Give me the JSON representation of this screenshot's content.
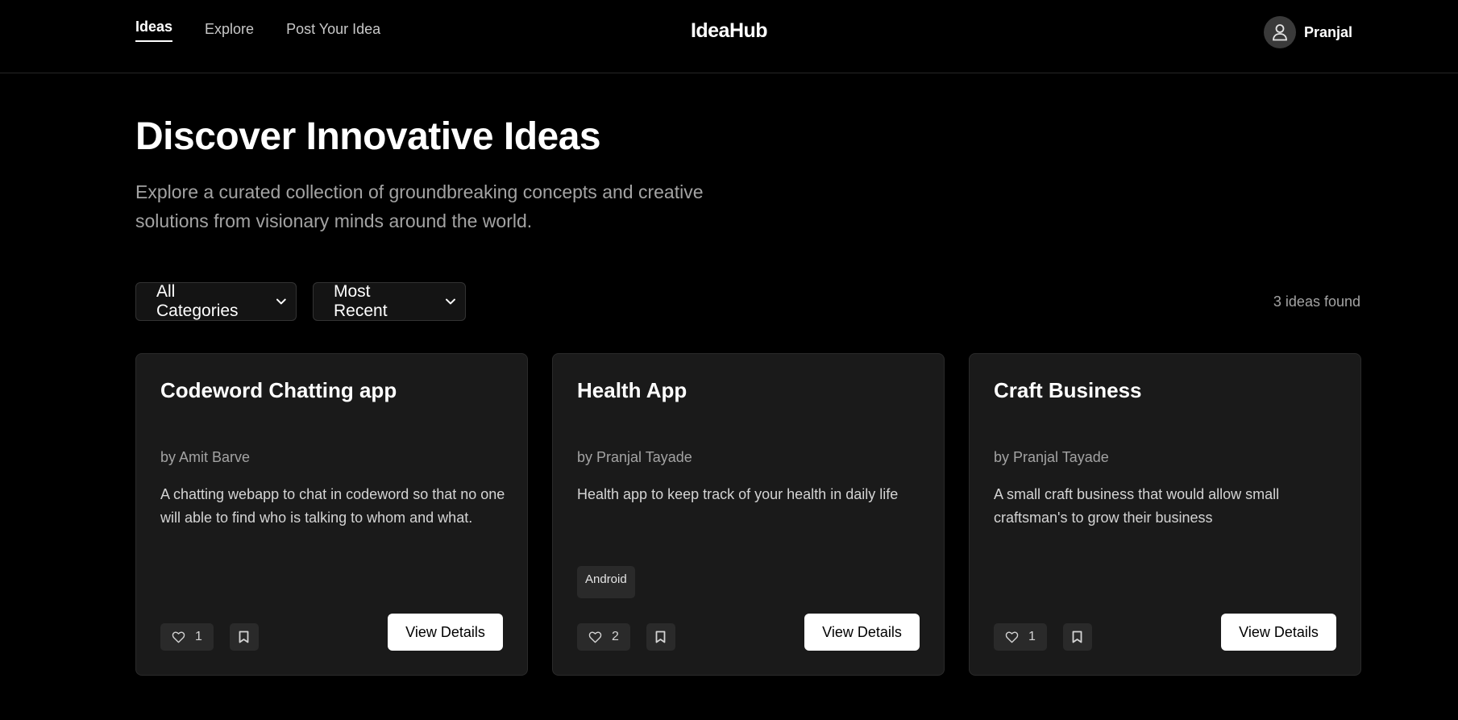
{
  "header": {
    "nav": [
      {
        "label": "Ideas",
        "active": true
      },
      {
        "label": "Explore",
        "active": false
      },
      {
        "label": "Post Your Idea",
        "active": false
      }
    ],
    "brand": "IdeaHub",
    "user": {
      "name": "Pranjal",
      "icon": "user-icon"
    }
  },
  "hero": {
    "title": "Discover Innovative Ideas",
    "subtitle": "Explore a curated collection of groundbreaking concepts and creative solutions from visionary minds around the world."
  },
  "filters": {
    "category": {
      "selected": "All Categories",
      "icon": "chevron-down-icon"
    },
    "sort": {
      "selected": "Most Recent",
      "icon": "chevron-down-icon"
    },
    "results": "3 ideas found"
  },
  "cards": [
    {
      "title": "Codeword Chatting app",
      "author": "by Amit Barve",
      "description": "A chatting webapp to chat in codeword so that no one will able to find who is talking to whom and what.",
      "tags": [],
      "likes": "1",
      "button": "View Details"
    },
    {
      "title": "Health App",
      "author": "by Pranjal Tayade",
      "description": "Health app to keep track of your health in daily life",
      "tags": [
        "Android"
      ],
      "likes": "2",
      "button": "View Details"
    },
    {
      "title": "Craft Business",
      "author": "by Pranjal Tayade",
      "description": "A small craft business that would allow small craftsman's to grow their business",
      "tags": [],
      "likes": "1",
      "button": "View Details"
    }
  ],
  "icons": {
    "like": "heart-icon",
    "bookmark": "bookmark-icon"
  }
}
